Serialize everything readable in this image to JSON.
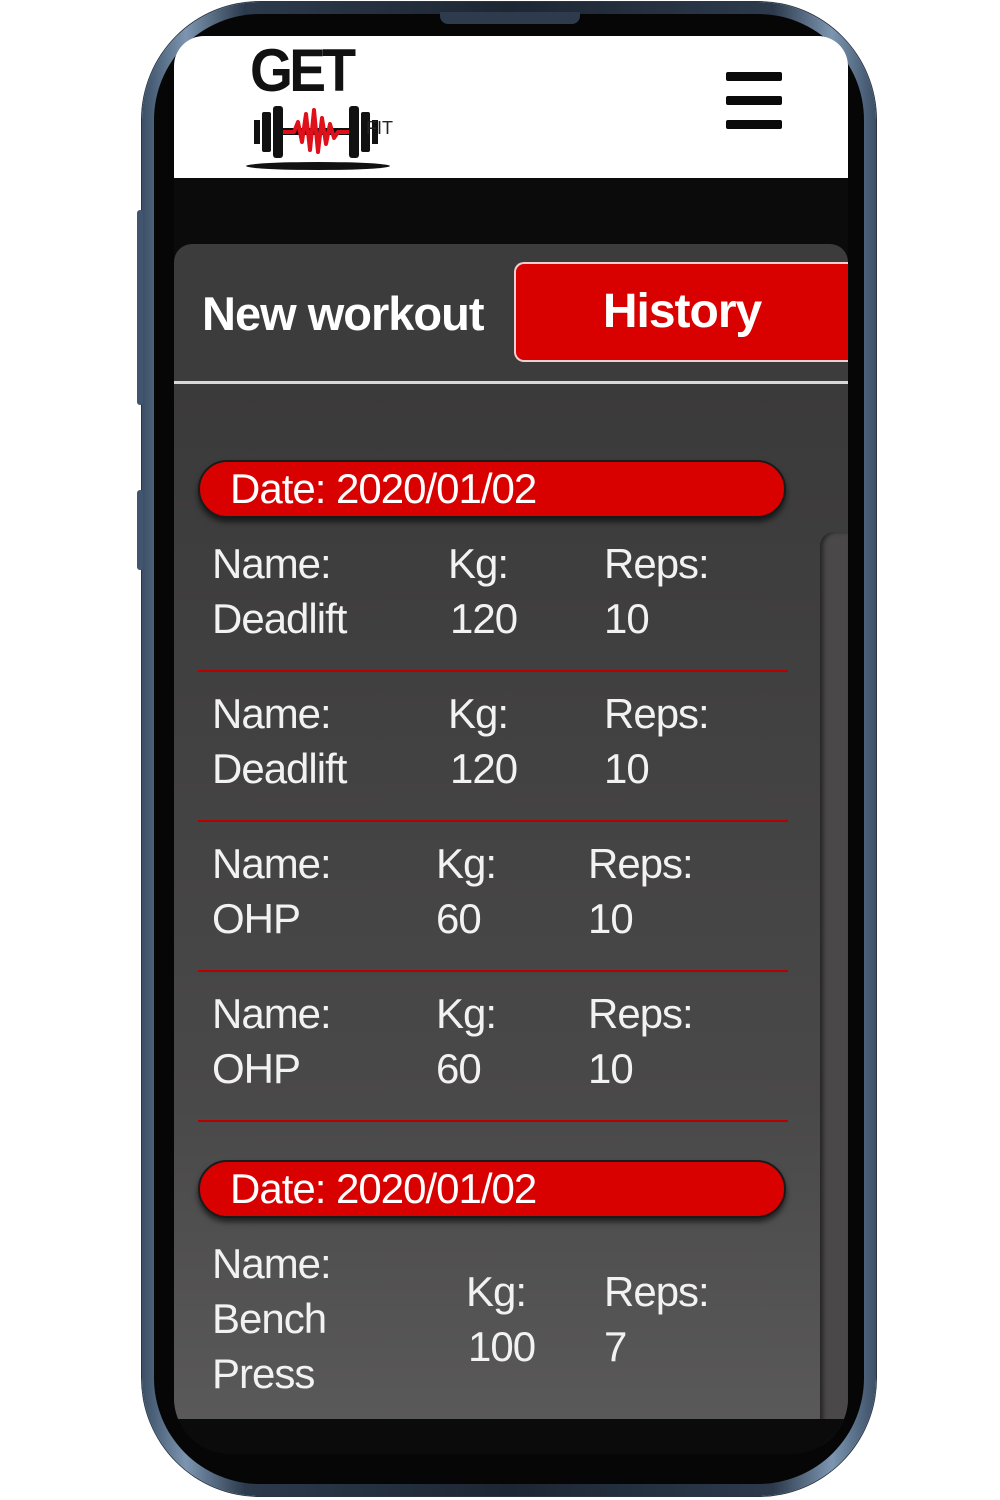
{
  "header": {
    "logo_text": "GET",
    "logo_sub": "FIT",
    "menu_icon": "hamburger-menu-icon"
  },
  "tabs": {
    "new_workout": "New workout",
    "history": "History",
    "active": "history"
  },
  "colors": {
    "accent": "#d90000",
    "panel": "#3d3c3c",
    "header_bg": "#ffffff"
  },
  "history": [
    {
      "date_label": "Date: 2020/01/02",
      "entries": [
        {
          "name_label": "Name:",
          "name": "Deadlift",
          "kg_label": "Kg:",
          "kg": "120",
          "reps_label": "Reps:",
          "reps": "10"
        },
        {
          "name_label": "Name:",
          "name": "Deadlift",
          "kg_label": "Kg:",
          "kg": "120",
          "reps_label": "Reps:",
          "reps": "10"
        },
        {
          "name_label": "Name:",
          "name": "OHP",
          "kg_label": "Kg:",
          "kg": "60",
          "reps_label": "Reps:",
          "reps": "10"
        },
        {
          "name_label": "Name:",
          "name": "OHP",
          "kg_label": "Kg:",
          "kg": "60",
          "reps_label": "Reps:",
          "reps": "10"
        }
      ]
    },
    {
      "date_label": "Date: 2020/01/02",
      "entries": [
        {
          "name_label": "Name:",
          "name": "Bench Press",
          "name_line1": "Bench",
          "name_line2": "Press",
          "kg_label": "Kg:",
          "kg": "100",
          "reps_label": "Reps:",
          "reps": "7"
        }
      ]
    }
  ]
}
